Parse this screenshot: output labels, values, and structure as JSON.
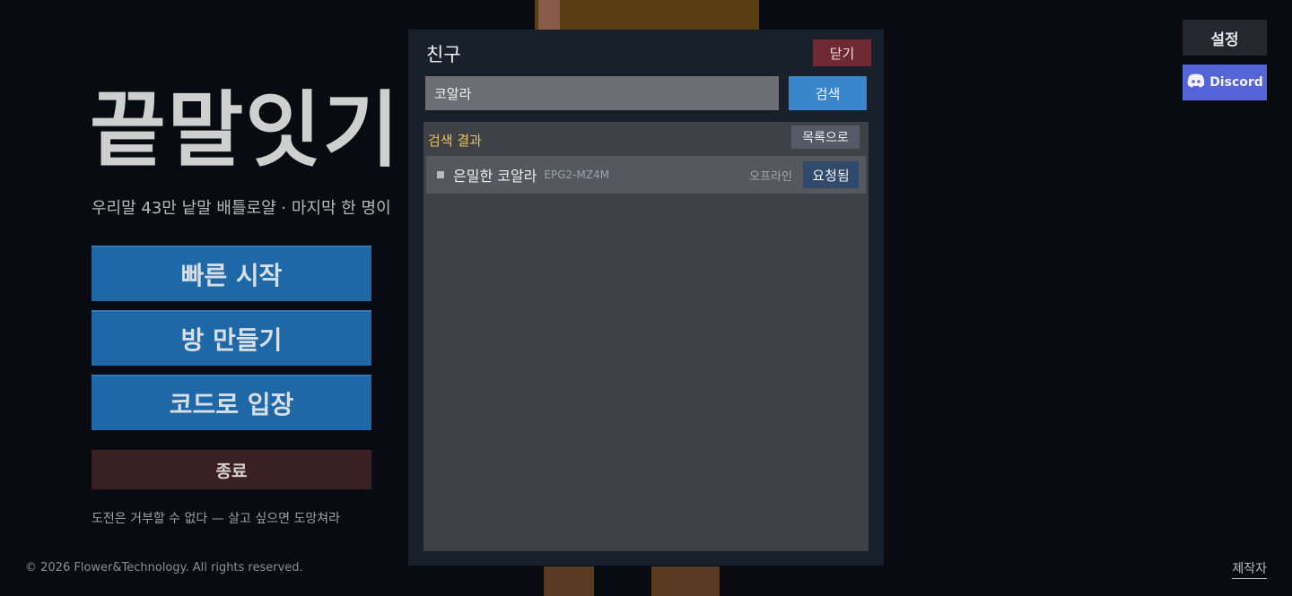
{
  "app": {
    "title": "끝말잇기",
    "subtitle": "우리말 43만 낱말 배틀로얄 · 마지막 한 명이",
    "tagline": "도전은 거부할 수 없다 — 살고 싶으면 도망쳐라",
    "copyright": "© 2026 Flower&Technology. All rights reserved.",
    "credits_label": "제작자"
  },
  "menu": {
    "quick_start": "빠른 시작",
    "create_room": "방 만들기",
    "join_by_code": "코드로 입장",
    "exit": "종료"
  },
  "top_right": {
    "settings_label": "설정",
    "discord_label": "Discord",
    "discord_icon": "discord-icon"
  },
  "friends_modal": {
    "title": "친구",
    "close_label": "닫기",
    "search": {
      "value": "코알라",
      "button_label": "검색"
    },
    "results": {
      "header": "검색 결과",
      "back_label": "목록으로",
      "items": [
        {
          "name": "은밀한 코알라",
          "code": "EPG2-MZ4M",
          "status": "오프라인",
          "action_label": "요청됨"
        }
      ]
    }
  },
  "colors": {
    "background": "#0a0b10",
    "menu_button": "#1f68a8",
    "exit_button": "#3a2020",
    "discord": "#5563d8",
    "close_button": "#6e2a32",
    "search_button": "#3a86cc",
    "results_header": "#e8c060"
  }
}
